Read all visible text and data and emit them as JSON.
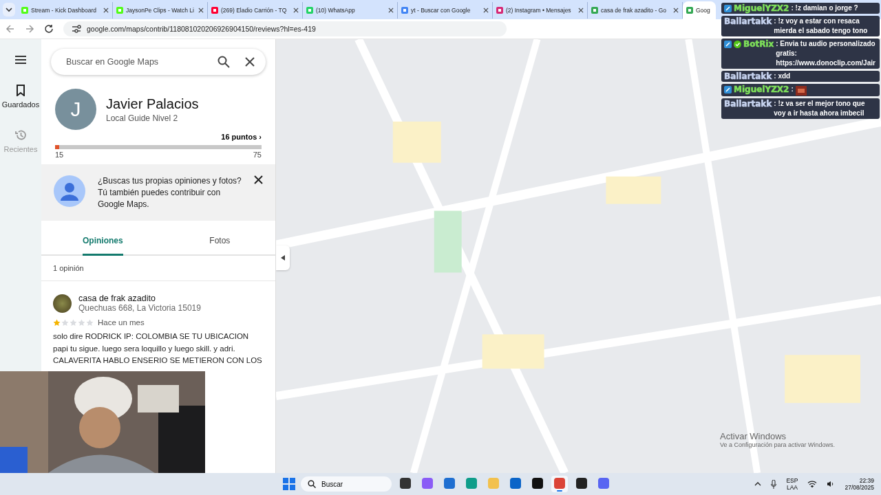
{
  "browser": {
    "tabs": [
      {
        "title": "Stream - Kick Dashboard",
        "kind": "kick",
        "selected": false
      },
      {
        "title": "JaysonPe Clips - Watch Li",
        "kind": "kick",
        "selected": false
      },
      {
        "title": "(269) Eladio Carrión - TQ",
        "kind": "youtube",
        "selected": false
      },
      {
        "title": "(10) WhatsApp",
        "kind": "whatsapp",
        "selected": false
      },
      {
        "title": "yt - Buscar con Google",
        "kind": "google",
        "selected": false
      },
      {
        "title": "(2) Instagram • Mensajes",
        "kind": "instagram",
        "selected": false
      },
      {
        "title": "casa de frak azadito - Go",
        "kind": "maps",
        "selected": false
      },
      {
        "title": "Goog",
        "kind": "maps",
        "selected": true
      }
    ],
    "url": "google.com/maps/contrib/118081020206926904150/reviews?hl=es-419"
  },
  "rail": [
    {
      "label": "Guardados",
      "kind": "bookmark",
      "selected": true
    },
    {
      "label": "Recientes",
      "kind": "history",
      "selected": false
    }
  ],
  "search": {
    "placeholder": "Buscar en Google Maps"
  },
  "profile": {
    "initial": "J",
    "name": "Javier Palacios",
    "subtitle": "Local Guide Nivel 2",
    "points": "16 puntos ›",
    "level": 0.017,
    "min": "15",
    "max": "75"
  },
  "promo": {
    "text": "¿Buscas tus propias opiniones y fotos? Tú también puedes contribuir con Google Maps."
  },
  "tabs": [
    {
      "label": "Opiniones",
      "selected": true
    },
    {
      "label": "Fotos",
      "selected": false
    }
  ],
  "count": "1 opinión",
  "review": {
    "place": "casa de frak azadito",
    "address": "Quechuas 668, La Victoria 15019",
    "stars": 1,
    "time": "Hace un mes",
    "text": "solo dire RODRICK IP: COLOMBIA SE TU UBICACION papi tu sigue. luego sera loquillo y luego skill. y adri. CALAVERITA HABLO ENSERIO SE METIERON CON LOS"
  },
  "map": {
    "kind": "picture",
    "watermark": [
      "Activar Windows",
      "Ve a Configuración para activar Windows."
    ]
  },
  "chat": [
    {
      "user": "MiguelYZX2",
      "kind": "highlighted",
      "text": ": !z damian o jorge ?",
      "badge": true,
      "check": false
    },
    {
      "user": "Ballartakk",
      "kind": "regular",
      "text": ": !z voy a estar con resaca mierda el sabado tengo tono",
      "badge": false,
      "check": false
    },
    {
      "user": "BotRix",
      "kind": "highlighted",
      "text": ": Envia tu audio personalizado gratis: https://www.donoclip.com/Jair",
      "badge": true,
      "check": true
    },
    {
      "user": "Ballartakk",
      "kind": "regular",
      "text": ": xdd",
      "badge": false,
      "check": false
    },
    {
      "user": "MiguelYZX2",
      "kind": "highlighted",
      "text": ":",
      "badge": true,
      "check": false,
      "emote": true
    },
    {
      "user": "Ballartakk",
      "kind": "regular",
      "text": ": !z va ser el mejor tono que voy a ir hasta ahora imbecil",
      "badge": false,
      "check": false
    }
  ],
  "taskbar": {
    "search": "Buscar",
    "apps": [
      {
        "kind": "files",
        "selected": false
      },
      {
        "kind": "copilot",
        "selected": false
      },
      {
        "kind": "store",
        "selected": false
      },
      {
        "kind": "edge",
        "selected": false
      },
      {
        "kind": "explorer",
        "selected": false
      },
      {
        "kind": "outlook",
        "selected": false
      },
      {
        "kind": "tiktok",
        "selected": false
      },
      {
        "kind": "chrome",
        "selected": true
      },
      {
        "kind": "obs",
        "selected": false
      },
      {
        "kind": "discord",
        "selected": false
      }
    ],
    "lang": "ESP",
    "layout": "LAA",
    "time": "22:39",
    "date": "27/08/2025"
  }
}
